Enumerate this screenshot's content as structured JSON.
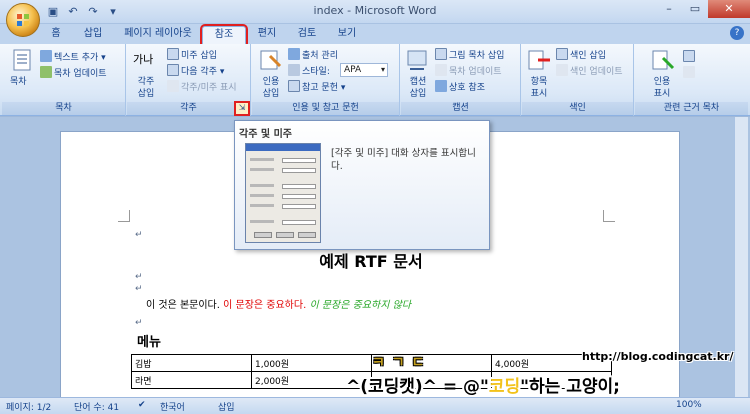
{
  "window": {
    "title": "index - Microsoft Word"
  },
  "tabs": [
    {
      "label": "홈"
    },
    {
      "label": "삽입"
    },
    {
      "label": "페이지 레이아웃"
    },
    {
      "label": "참조"
    },
    {
      "label": "편지"
    },
    {
      "label": "검토"
    },
    {
      "label": "보기"
    }
  ],
  "ribbon": {
    "toc": {
      "big": "목차",
      "add_text": "텍스트 추가",
      "update": "목차 업데이트",
      "label": "목차"
    },
    "footnotes": {
      "big_top": "가나",
      "big_bottom": "각주 삽입",
      "insert_endnote": "미주 삽입",
      "next_footnote": "다음 각주",
      "show_notes": "각주/미주 표시",
      "label": "각주"
    },
    "citations": {
      "big": "인용 삽입",
      "manage": "출처 관리",
      "style_label": "스타일:",
      "style_value": "APA",
      "bibliography": "참고 문헌",
      "label": "인용 및 참고 문헌"
    },
    "captions": {
      "big": "캡션 삽입",
      "insert_tof": "그림 목차 삽입",
      "update_table": "목차 업데이트",
      "cross_ref": "상호 참조",
      "label": "캡션"
    },
    "index": {
      "big": "항목 표시",
      "insert_index": "색인 삽입",
      "update_index": "색인 업데이트",
      "label": "색인"
    },
    "authorities": {
      "big": "인용 표시",
      "label": "관련 근거 목차"
    }
  },
  "tooltip": {
    "title": "각주 및 미주",
    "description": "[각주 및 미주] 대화 상자를 표시합니다."
  },
  "document": {
    "title": "예제 RTF 문서",
    "body_plain": "이 것은 본문이다.",
    "body_red": "이 문장은 중요하다.",
    "body_green": "이 문장은 중요하지 않다",
    "menu_heading": "메뉴",
    "table": [
      [
        "김밥",
        "1,000원",
        "",
        "4,000원"
      ],
      [
        "라면",
        "2,000원",
        "",
        ""
      ]
    ]
  },
  "statusbar": {
    "page": "페이지: 1/2",
    "words": "단어 수: 41",
    "lang": "한국어",
    "mode": "삽입",
    "zoom": "100%"
  },
  "watermark": {
    "url": "http://blog.codingcat.kr/",
    "logo": "ㅋ ㄱ ㄷ",
    "line_a": "^(코딩캣)^ = @\"",
    "line_b": "코딩",
    "line_c": "\"하는 고양이;"
  }
}
